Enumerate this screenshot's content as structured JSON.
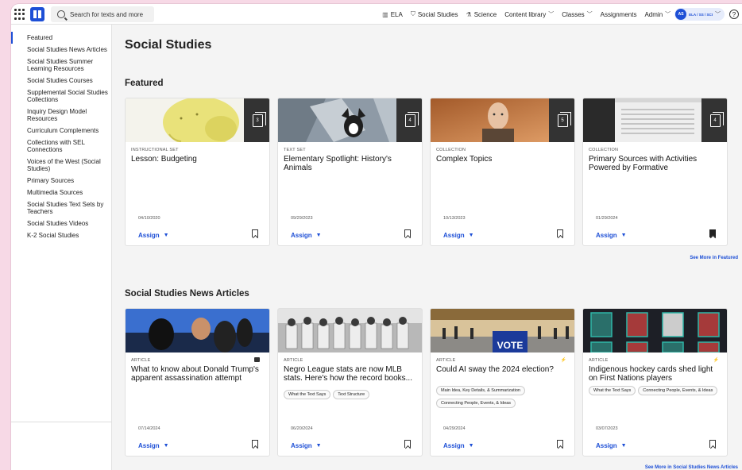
{
  "topbar": {
    "search_placeholder": "Search for texts and more",
    "nav": [
      {
        "icon": "book-icon",
        "glyph": "▥",
        "label": "ELA"
      },
      {
        "icon": "shield-icon",
        "glyph": "⛉",
        "label": "Social Studies"
      },
      {
        "icon": "flask-icon",
        "glyph": "⚗",
        "label": "Science"
      }
    ],
    "content_library": "Content library",
    "classes": "Classes",
    "assignments": "Assignments",
    "admin": "Admin",
    "user_initials": "AS",
    "user_label": "ELA / SS / SCI",
    "help": "?"
  },
  "sidebar": {
    "items": [
      "Featured",
      "Social Studies News Articles",
      "Social Studies Summer Learning Resources",
      "Social Studies Courses",
      "Supplemental Social Studies Collections",
      "Inquiry Design Model Resources",
      "Curriculum Complements",
      "Collections with SEL Connections",
      "Voices of the West (Social Studies)",
      "Primary Sources",
      "Multimedia Sources",
      "Social Studies Text Sets by Teachers",
      "Social Studies Videos",
      "K-2 Social Studies"
    ]
  },
  "main": {
    "page_title": "Social Studies",
    "featured_title": "Featured",
    "featured_see_more": "See More in Featured",
    "news_title": "Social Studies News Articles",
    "news_see_more": "See More in Social Studies News Articles",
    "assign_label": "Assign",
    "featured_cards": [
      {
        "type": "INSTRUCTIONAL SET",
        "title": "Lesson: Budgeting",
        "date": "04/10/2020",
        "count": "3",
        "bookmarked": false
      },
      {
        "type": "TEXT SET",
        "title": "Elementary Spotlight: History's Animals",
        "date": "09/29/2023",
        "count": "4",
        "bookmarked": false
      },
      {
        "type": "COLLECTION",
        "title": "Complex Topics",
        "date": "10/13/2023",
        "count": "5",
        "bookmarked": false
      },
      {
        "type": "COLLECTION",
        "title": "Primary Sources with Activities Powered by Formative",
        "date": "01/29/2024",
        "count": "4",
        "bookmarked": true
      }
    ],
    "news_cards": [
      {
        "type": "ARTICLE",
        "title": "What to know about Donald Trump's apparent assassination attempt",
        "date": "07/14/2024",
        "tags": [],
        "badge": "square"
      },
      {
        "type": "ARTICLE",
        "title": "Negro League stats are now MLB stats. Here's how the record books...",
        "date": "06/20/2024",
        "tags": [
          "What the Text Says",
          "Text Structure"
        ],
        "badge": "none"
      },
      {
        "type": "ARTICLE",
        "title": "Could AI sway the 2024 election?",
        "date": "04/29/2024",
        "tags": [
          "Main Idea, Key Details, & Summarization",
          "Connecting People, Events, & Ideas"
        ],
        "badge": "bolt"
      },
      {
        "type": "ARTICLE",
        "title": "Indigenous hockey cards shed light on First Nations players",
        "date": "03/07/2023",
        "tags": [
          "What the Text Says",
          "Connecting People, Events, & Ideas"
        ],
        "badge": "bolt"
      }
    ]
  }
}
